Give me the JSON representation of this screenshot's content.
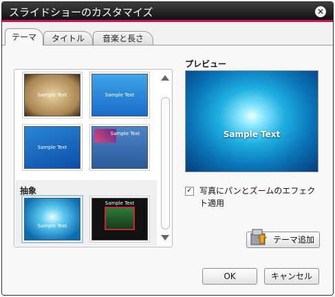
{
  "window": {
    "title": "スライドショーのカスタマイズ"
  },
  "tabs": [
    {
      "label": "テーマ",
      "active": true
    },
    {
      "label": "タイトル",
      "active": false
    },
    {
      "label": "音楽と長さ",
      "active": false
    }
  ],
  "themes": {
    "sample_text": "Sample Text",
    "section_abstract": "抽象"
  },
  "preview": {
    "label": "プレビュー",
    "sample_text": "Sample Text"
  },
  "options": {
    "pan_zoom_label": "写真にパンとズームのエフェクト適用",
    "pan_zoom_checked": true
  },
  "buttons": {
    "add_theme": "テーマ追加",
    "ok": "OK",
    "cancel": "キャンセル"
  },
  "colors": {
    "accent": "#d0115d",
    "titlebar": "#111111"
  }
}
